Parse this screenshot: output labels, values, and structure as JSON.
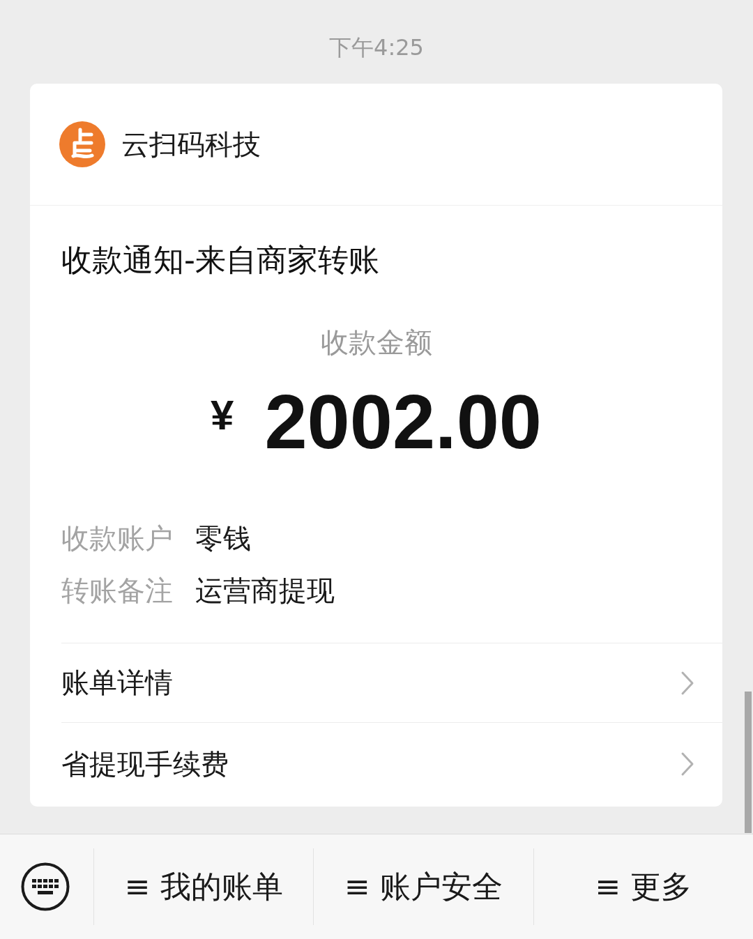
{
  "timestamp": "下午4:25",
  "message": {
    "sender": {
      "name": "云扫码科技"
    },
    "title": "收款通知-来自商家转账",
    "amount_label": "收款金额",
    "currency": "¥",
    "amount": "2002.00",
    "details": [
      {
        "label": "收款账户",
        "value": "零钱"
      },
      {
        "label": "转账备注",
        "value": "运营商提现"
      }
    ],
    "links": [
      {
        "label": "账单详情"
      },
      {
        "label": "省提现手续费"
      }
    ]
  },
  "menu_bar": {
    "items": [
      {
        "label": "≡ 我的账单"
      },
      {
        "label": "≡ 账户安全"
      },
      {
        "label": "≡ 更多"
      }
    ]
  }
}
